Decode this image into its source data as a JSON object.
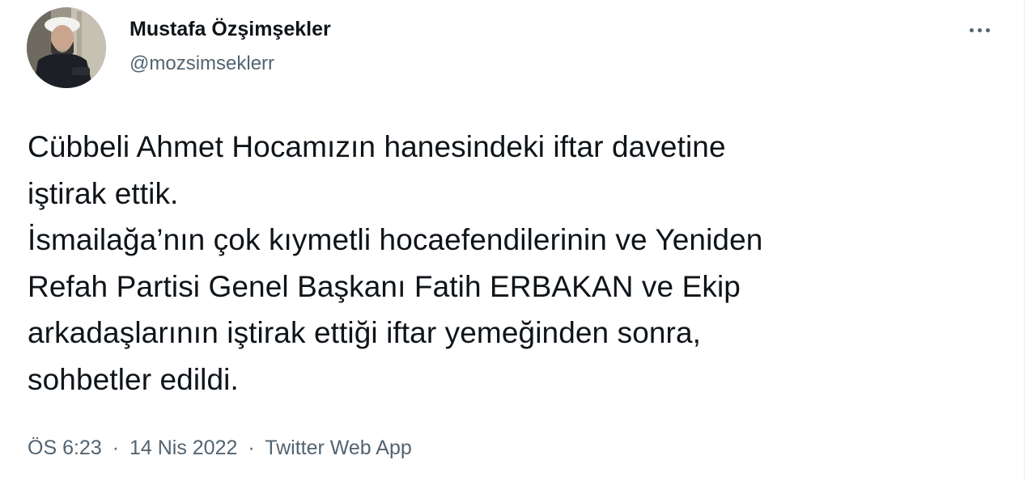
{
  "author": {
    "display_name": "Mustafa Özşimşekler",
    "handle": "@mozsimseklerr",
    "avatar_icon": "profile-photo"
  },
  "more_icon": "more-horizontal-icon",
  "tweet": {
    "lines": [
      "Cübbeli Ahmet Hocamızın hanesindeki iftar davetine",
      "iştirak ettik.",
      "İsmailağa’nın çok kıymetli hocaefendilerinin ve Yeniden",
      "Refah Partisi Genel Başkanı Fatih ERBAKAN ve Ekip",
      "arkadaşlarının iştirak ettiği iftar yemeğinden sonra,",
      "sohbetler edildi."
    ]
  },
  "meta": {
    "time": "ÖS 6:23",
    "separator": "·",
    "date": "14 Nis 2022",
    "source": "Twitter Web App"
  },
  "colors": {
    "text_primary": "#0f1419",
    "text_secondary": "#536471",
    "background": "#ffffff"
  }
}
